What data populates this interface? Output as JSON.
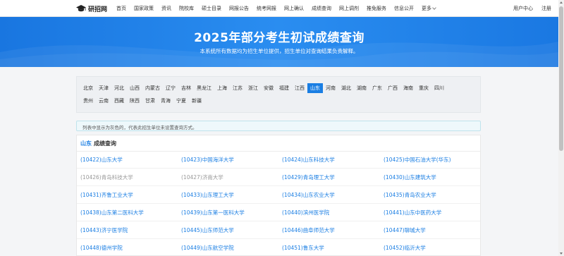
{
  "brand": {
    "logo_text": "研招网",
    "logo_icon": "mortarboard-icon"
  },
  "nav": {
    "items": [
      "首页",
      "国家政策",
      "资讯",
      "院校库",
      "硕士目录",
      "网报公告",
      "统考网报",
      "网上确认",
      "成绩查询",
      "网上调剂",
      "推免服务",
      "信息公开"
    ],
    "more": "更多",
    "user_center": "用户中心",
    "register": "注册"
  },
  "hero": {
    "title": "2025年部分考生初试成绩查询",
    "subtitle": "本系统所有数据均为招生单位提供，招生单位对查询结果负责解释。"
  },
  "provinces": {
    "row1": [
      "北京",
      "天津",
      "河北",
      "山西",
      "内蒙古",
      "辽宁",
      "吉林",
      "黑龙江",
      "上海",
      "江苏",
      "浙江",
      "安徽",
      "福建",
      "江西",
      "山东",
      "河南",
      "湖北",
      "湖南",
      "广东",
      "广西",
      "海南",
      "重庆",
      "四川"
    ],
    "row2": [
      "贵州",
      "云南",
      "西藏",
      "陕西",
      "甘肃",
      "青海",
      "宁夏",
      "新疆"
    ],
    "active": "山东"
  },
  "notice": "列表中显示为灰色的，代表此招生单位未设置查询方式。",
  "results": {
    "province": "山东",
    "title_suffix": "成绩查询",
    "universities": [
      [
        {
          "name": "(10422)山东大学",
          "grey": false
        },
        {
          "name": "(10423)中国海洋大学",
          "grey": false
        },
        {
          "name": "(10424)山东科技大学",
          "grey": false
        },
        {
          "name": "(10425)中国石油大学(华东)",
          "grey": false
        }
      ],
      [
        {
          "name": "(10426)青岛科技大学",
          "grey": true
        },
        {
          "name": "(10427)济南大学",
          "grey": true
        },
        {
          "name": "(10429)青岛理工大学",
          "grey": false
        },
        {
          "name": "(10430)山东建筑大学",
          "grey": false
        }
      ],
      [
        {
          "name": "(10431)齐鲁工业大学",
          "grey": false
        },
        {
          "name": "(10433)山东理工大学",
          "grey": false
        },
        {
          "name": "(10434)山东农业大学",
          "grey": false
        },
        {
          "name": "(10435)青岛农业大学",
          "grey": false
        }
      ],
      [
        {
          "name": "(10438)山东第二医科大学",
          "grey": false
        },
        {
          "name": "(10439)山东第一医科大学",
          "grey": false
        },
        {
          "name": "(10440)滨州医学院",
          "grey": false
        },
        {
          "name": "(10441)山东中医药大学",
          "grey": false
        }
      ],
      [
        {
          "name": "(10443)济宁医学院",
          "grey": false
        },
        {
          "name": "(10445)山东师范大学",
          "grey": false
        },
        {
          "name": "(10446)曲阜师范大学",
          "grey": false
        },
        {
          "name": "(10447)聊城大学",
          "grey": false
        }
      ],
      [
        {
          "name": "(10448)德州学院",
          "grey": false
        },
        {
          "name": "(10449)山东航空学院",
          "grey": false
        },
        {
          "name": "(10451)鲁东大学",
          "grey": false
        },
        {
          "name": "(10452)临沂大学",
          "grey": false
        }
      ]
    ]
  },
  "colors": {
    "accent": "#1a7ee3",
    "hero": "#1f82e8",
    "grey_link": "#999999"
  }
}
